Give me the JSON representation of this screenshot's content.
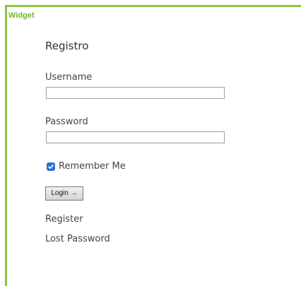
{
  "widget": {
    "label": "Widget",
    "accent_color": "#8cc63f"
  },
  "form": {
    "title": "Registro",
    "username_label": "Username",
    "username_value": "",
    "password_label": "Password",
    "password_value": "",
    "remember_label": "Remember Me",
    "remember_checked": true,
    "login_label": "Login →",
    "checkbox_color": "#2a6fd6"
  },
  "links": {
    "register": "Register",
    "lost_password": "Lost Password"
  }
}
